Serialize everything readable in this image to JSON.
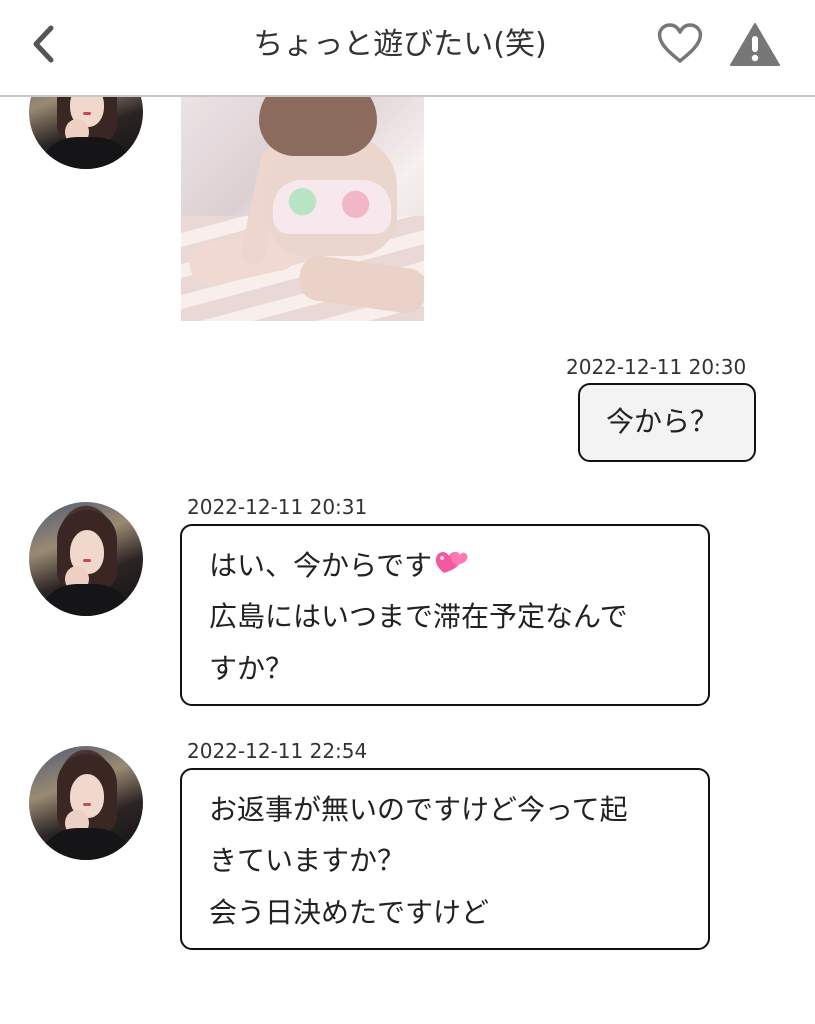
{
  "header": {
    "title": "ちょっと遊びたい(笑)"
  },
  "messages": [
    {
      "type": "received-image",
      "sender": "partner"
    },
    {
      "type": "sent",
      "timestamp": "2022-12-11 20:30",
      "text": "今から？"
    },
    {
      "type": "received",
      "timestamp": "2022-12-11 20:31",
      "lines": [
        "はい、今からです",
        "広島にはいつまで滞在予定なんで",
        "すか？"
      ]
    },
    {
      "type": "received",
      "timestamp": "2022-12-11 22:54",
      "lines": [
        "お返事が無いのですけど今って起",
        "きていますか？",
        "会う日決めたですけど"
      ]
    }
  ],
  "icons": {
    "back": "chevron-left-icon",
    "favorite": "heart-outline-icon",
    "report": "warning-triangle-icon",
    "emoji": "two-hearts-emoji"
  },
  "colors": {
    "header_divider": "#c8c8c8",
    "bubble_border": "#111111",
    "sent_bubble_background": "#f3f3f3",
    "text": "#222222",
    "icon_gray": "#777777",
    "heart_emoji": "#f25aa0"
  }
}
